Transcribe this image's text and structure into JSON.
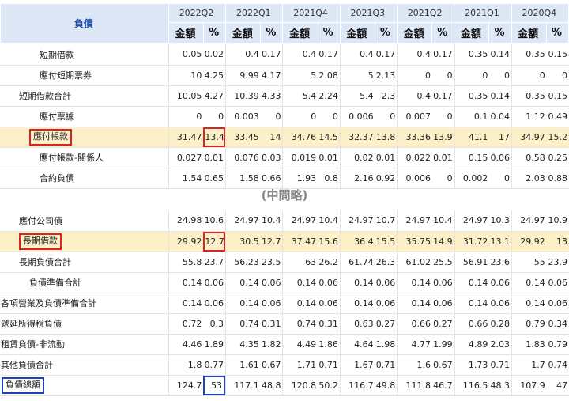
{
  "header": {
    "liability_label": "負債",
    "periods": [
      "2022Q2",
      "2022Q1",
      "2021Q4",
      "2021Q3",
      "2021Q2",
      "2021Q1",
      "2020Q4"
    ],
    "amount_label": "金額",
    "percent_label": "%"
  },
  "separator": "(中間略)",
  "section1": [
    {
      "label": "短期借款",
      "indent": "l1",
      "values": [
        "0.05",
        "0.02",
        "0.4",
        "0.17",
        "0.4",
        "0.17",
        "0.4",
        "0.17",
        "0.4",
        "0.17",
        "0.35",
        "0.14",
        "0.35",
        "0.15"
      ]
    },
    {
      "label": "應付短期票券",
      "indent": "l1",
      "values": [
        "10",
        "4.25",
        "9.99",
        "4.17",
        "5",
        "2.08",
        "5",
        "2.13",
        "0",
        "0",
        "0",
        "0",
        "0",
        "0"
      ]
    },
    {
      "label": "短期借款合計",
      "indent": "l3",
      "values": [
        "10.05",
        "4.27",
        "10.39",
        "4.33",
        "5.4",
        "2.24",
        "5.4",
        "2.3",
        "0.4",
        "0.17",
        "0.35",
        "0.14",
        "0.35",
        "0.15"
      ]
    },
    {
      "label": "應付票據",
      "indent": "l1",
      "values": [
        "0",
        "0",
        "0.003",
        "0",
        "0",
        "0",
        "0.006",
        "0",
        "0.007",
        "0",
        "0.1",
        "0.04",
        "1.12",
        "0.49"
      ]
    },
    {
      "label": "應付帳款",
      "indent": "l2",
      "highlight": true,
      "boxed_label": true,
      "boxed_pct": true,
      "values": [
        "31.47",
        "13.4",
        "33.45",
        "14",
        "34.76",
        "14.5",
        "32.37",
        "13.8",
        "33.36",
        "13.9",
        "41.1",
        "17",
        "34.97",
        "15.2"
      ]
    },
    {
      "label": "應付帳款-關係人",
      "indent": "l1",
      "values": [
        "0.027",
        "0.01",
        "0.076",
        "0.03",
        "0.019",
        "0.01",
        "0.02",
        "0.01",
        "0.022",
        "0.01",
        "0.15",
        "0.06",
        "0.58",
        "0.25"
      ]
    },
    {
      "label": "合約負債",
      "indent": "l1",
      "values": [
        "1.54",
        "0.65",
        "1.58",
        "0.66",
        "1.93",
        "0.8",
        "2.16",
        "0.92",
        "0.006",
        "0",
        "0.002",
        "0",
        "2.03",
        "0.88"
      ]
    }
  ],
  "section2": [
    {
      "label": "應付公司債",
      "indent": "l3",
      "values": [
        "24.98",
        "10.6",
        "24.97",
        "10.4",
        "24.97",
        "10.4",
        "24.97",
        "10.7",
        "24.97",
        "10.4",
        "24.97",
        "10.3",
        "24.97",
        "10.9"
      ]
    },
    {
      "label": "長期借款",
      "indent": "l3",
      "highlight": true,
      "boxed_label": true,
      "boxed_pct": true,
      "values": [
        "29.92",
        "12.7",
        "30.5",
        "12.7",
        "37.47",
        "15.6",
        "36.4",
        "15.5",
        "35.75",
        "14.9",
        "31.72",
        "13.1",
        "29.92",
        "13"
      ]
    },
    {
      "label": "長期負債合計",
      "indent": "l3",
      "values": [
        "55.8",
        "23.7",
        "56.23",
        "23.5",
        "63",
        "26.2",
        "61.74",
        "26.3",
        "61.02",
        "25.5",
        "56.91",
        "23.6",
        "55",
        "23.9"
      ]
    },
    {
      "label": "負債準備合計",
      "indent": "l2",
      "values": [
        "0.14",
        "0.06",
        "0.14",
        "0.06",
        "0.14",
        "0.06",
        "0.14",
        "0.06",
        "0.14",
        "0.06",
        "0.14",
        "0.06",
        "0.14",
        "0.06"
      ]
    },
    {
      "label": "各項營業及負債準備合計",
      "indent": "l4",
      "values": [
        "0.14",
        "0.06",
        "0.14",
        "0.06",
        "0.14",
        "0.06",
        "0.14",
        "0.06",
        "0.14",
        "0.06",
        "0.14",
        "0.06",
        "0.14",
        "0.06"
      ]
    },
    {
      "label": "遞延所得稅負債",
      "indent": "l4",
      "values": [
        "0.72",
        "0.3",
        "0.74",
        "0.31",
        "0.74",
        "0.31",
        "0.63",
        "0.27",
        "0.66",
        "0.27",
        "0.66",
        "0.28",
        "0.79",
        "0.34"
      ]
    },
    {
      "label": "租賃負債-非流動",
      "indent": "l4",
      "values": [
        "4.46",
        "1.89",
        "4.35",
        "1.82",
        "4.49",
        "1.86",
        "4.64",
        "1.98",
        "4.77",
        "1.99",
        "4.89",
        "2.03",
        "1.83",
        "0.79"
      ]
    },
    {
      "label": "其他負債合計",
      "indent": "l4",
      "values": [
        "1.8",
        "0.77",
        "1.61",
        "0.67",
        "1.71",
        "0.71",
        "1.67",
        "0.71",
        "1.6",
        "0.67",
        "1.73",
        "0.71",
        "1.7",
        "0.74"
      ]
    },
    {
      "label": "負債總額",
      "indent": "l0",
      "boxed_label": true,
      "boxed_pct": true,
      "blue": true,
      "values": [
        "124.7",
        "53",
        "117.1",
        "48.8",
        "120.8",
        "50.2",
        "116.7",
        "49.8",
        "111.8",
        "46.7",
        "116.5",
        "48.3",
        "107.9",
        "47"
      ]
    }
  ]
}
